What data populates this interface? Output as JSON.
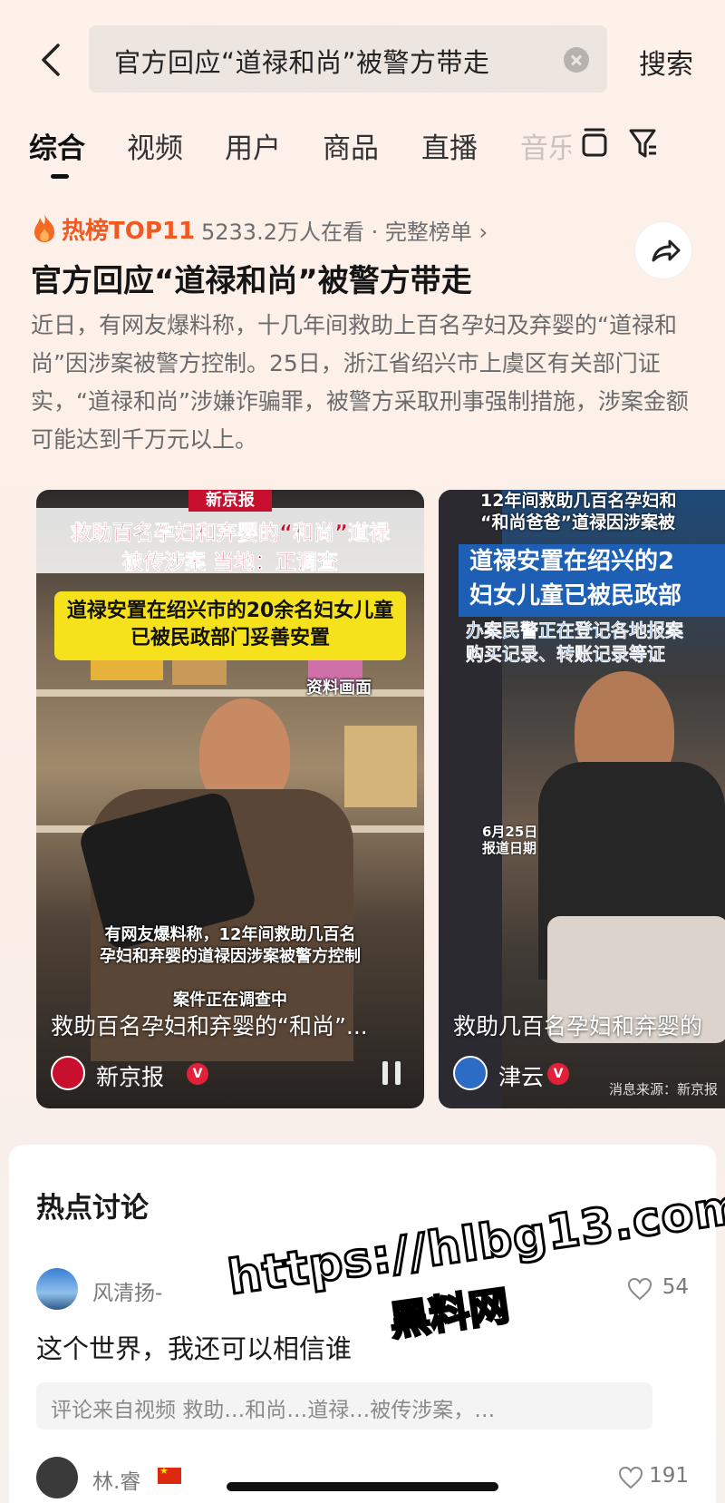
{
  "search": {
    "query": "官方回应“道禄和尚”被警方带走",
    "submit_label": "搜索"
  },
  "tabs": [
    {
      "label": "综合",
      "active": true
    },
    {
      "label": "视频"
    },
    {
      "label": "用户"
    },
    {
      "label": "商品"
    },
    {
      "label": "直播"
    },
    {
      "label": "音乐"
    }
  ],
  "hot": {
    "badge": "热榜TOP11",
    "meta": "5233.2万人在看 · 完整榜单 ›",
    "headline": "官方回应“道禄和尚”被警方带走",
    "summary": "近日，有网友爆料称，十几年间救助上百名孕妇及弃婴的“道禄和尚”因涉案被警方控制。25日，浙江省绍兴市上虞区有关部门证实，“道禄和尚”涉嫌诈骗罪，被警方采取刑事强制措施，涉案金额可能达到千万元以上。"
  },
  "videos": [
    {
      "brand": "新京报",
      "caption_red_1": "救助百名孕妇和弃婴的“和尚”道禄",
      "caption_red_2": "被传涉案 当地：正调查",
      "caption_yellow_1": "道禄安置在绍兴市的20余名妇女儿童",
      "caption_yellow_2": "已被民政部门妥善安置",
      "overlay_label": "资料画面",
      "sub_1": "有网友爆料称，12年间救助几百名",
      "sub_2": "孕妇和弃婴的道禄因涉案被警方控制",
      "sub_3": "案件正在调查中",
      "title": "救助百名孕妇和弃婴的“和尚”...",
      "author": "新京报"
    },
    {
      "top_cap_1": "12年间救助几百名孕妇和",
      "top_cap_2": "“和尚爸爸”道禄因涉案被",
      "blue_1": "道禄安置在绍兴的2",
      "blue_2": "妇女儿童已被民政部",
      "blue_sub_1": "办案民警正在登记各地报案",
      "blue_sub_2": "购买记录、转账记录等证",
      "date_1": "6月25日",
      "date_2": "报道日期",
      "title": "救助几百名孕妇和弃婴的",
      "author": "津云",
      "source_note": "消息来源：新京报"
    }
  ],
  "discussion": {
    "title": "热点讨论",
    "comments": [
      {
        "user": "风清扬-",
        "likes": "54",
        "text": "这个世界，我还可以相信谁",
        "ref": "评论来自视频 救助…和尚…道禄…被传涉案，…"
      },
      {
        "user": "林.睿",
        "likes": "191"
      }
    ]
  },
  "watermark": {
    "url": "https://hlbg13.com",
    "name": "黑料网"
  }
}
